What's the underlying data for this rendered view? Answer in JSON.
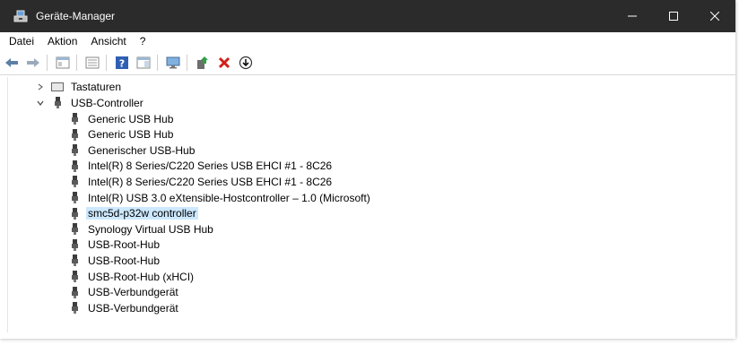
{
  "window": {
    "title": "Geräte-Manager"
  },
  "menu": [
    "Datei",
    "Aktion",
    "Ansicht",
    "?"
  ],
  "toolbar": {
    "icons": [
      "back-arrow-icon",
      "forward-arrow-icon",
      "properties-view-icon",
      "details-view-icon",
      "help-icon",
      "panel-view-icon",
      "monitor-icon",
      "update-driver-icon",
      "uninstall-icon",
      "disable-icon"
    ]
  },
  "tree": {
    "collapsed_group": "Tastaturen",
    "expanded_group": "USB-Controller",
    "devices": [
      "Generic USB Hub",
      "Generic USB Hub",
      "Generischer USB-Hub",
      "Intel(R) 8 Series/C220 Series USB EHCI #1 - 8C26",
      "Intel(R) 8 Series/C220 Series USB EHCI #1 - 8C26",
      "Intel(R) USB 3.0 eXtensible-Hostcontroller – 1.0 (Microsoft)",
      "smc5d-p32w controller",
      "Synology Virtual USB Hub",
      "USB-Root-Hub",
      "USB-Root-Hub",
      "USB-Root-Hub (xHCI)",
      "USB-Verbundgerät",
      "USB-Verbundgerät"
    ],
    "selected_index": 6
  },
  "colors": {
    "titlebar": "#2b2b2b",
    "selection": "#cce8ff"
  }
}
